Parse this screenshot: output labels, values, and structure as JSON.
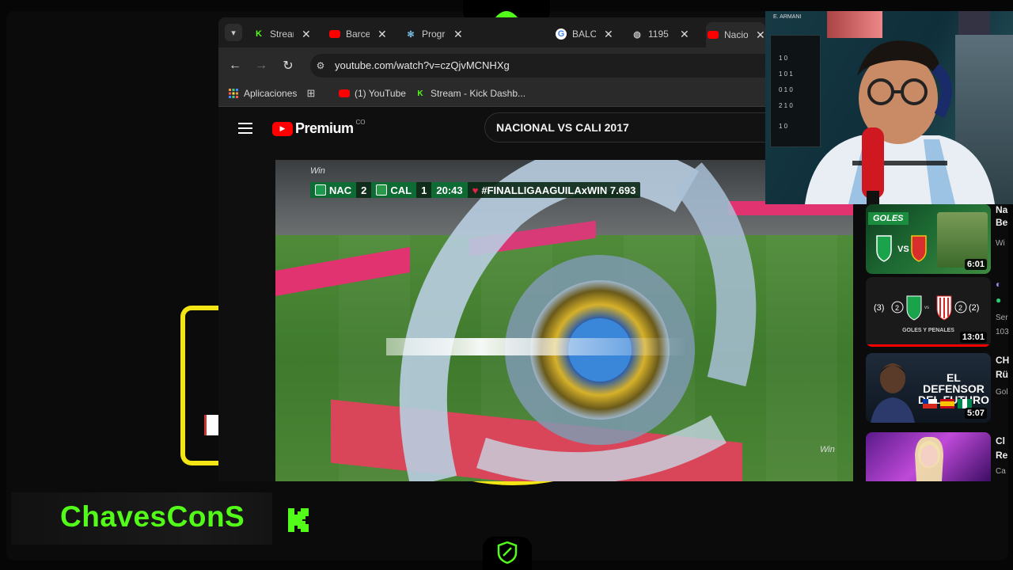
{
  "browser": {
    "tabs": [
      {
        "title": "Stream",
        "favicon": "kick-icon"
      },
      {
        "title": "Barcelona",
        "favicon": "youtube-icon"
      },
      {
        "title": "Programa",
        "favicon": "gear-icon"
      },
      {
        "title": "BALON",
        "favicon": "google-icon"
      },
      {
        "title": "1195",
        "favicon": "globe-icon"
      },
      {
        "title": "Nacional",
        "favicon": "youtube-icon"
      }
    ],
    "url": "youtube.com/watch?v=czQjvMCNHXg",
    "bookmarks": [
      {
        "label": "Aplicaciones",
        "icon": "apps-grid-icon"
      },
      {
        "label": "",
        "icon": "grid-icon"
      },
      {
        "label": "(1) YouTube",
        "icon": "youtube-icon"
      },
      {
        "label": "Stream - Kick Dashb...",
        "icon": "kick-icon"
      }
    ]
  },
  "youtube": {
    "logo_text": "Premium",
    "country": "CO",
    "search_query": "NACIONAL VS CALI 2017"
  },
  "video": {
    "broadcaster": "Win",
    "scorebug": {
      "team1": "NAC",
      "score1": "2",
      "team2": "CAL",
      "score2": "1",
      "clock": "20:43",
      "hashtag": "#FINALLIGAAGUILAxWIN",
      "count": "7.693"
    }
  },
  "related": [
    {
      "tag": "GOLES",
      "duration": "6:01",
      "side_title": "Na",
      "side_line2": "Be",
      "side_line3": "Wi"
    },
    {
      "tag": "",
      "caption": "GOLES Y PENALES",
      "duration": "13:01",
      "side_title": "",
      "side_line2": "Ser",
      "side_line3": "103"
    },
    {
      "headline": "EL DEFENSOR DEL FUTURO",
      "duration": "5:07",
      "side_title": "CH",
      "side_line2": "Rü",
      "side_line3": "Gol"
    },
    {
      "duration": "",
      "side_title": "Cl",
      "side_line2": "Re",
      "side_line3": "Ca"
    }
  ],
  "webcam": {
    "wall_label": "E. ARMANI",
    "board_rows": [
      "1 0",
      "1 0 1",
      "0 1 0",
      "2 1 0",
      "1 0"
    ]
  },
  "stream": {
    "channel_name": "ChavesConS",
    "accent": "#53fc18",
    "frame_yellow": "#f4e514"
  }
}
